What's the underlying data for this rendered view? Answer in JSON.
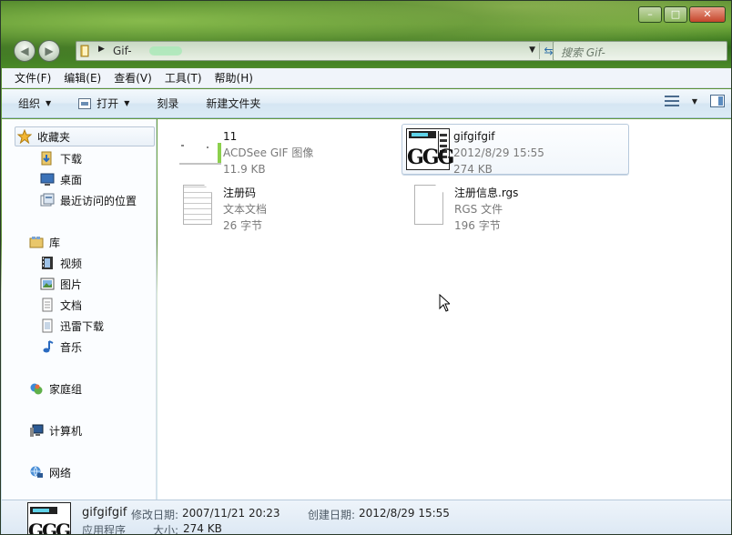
{
  "address": {
    "path": "Gif-"
  },
  "search": {
    "placeholder": "搜索 Gif-"
  },
  "menu": [
    "文件(F)",
    "编辑(E)",
    "查看(V)",
    "工具(T)",
    "帮助(H)"
  ],
  "commands": {
    "organize": "组织",
    "open": "打开",
    "burn": "刻录",
    "new_folder": "新建文件夹"
  },
  "nav": {
    "favorites": "收藏夹",
    "downloads": "下载",
    "desktop": "桌面",
    "recent": "最近访问的位置",
    "libraries": "库",
    "videos": "视频",
    "pictures": "图片",
    "documents": "文档",
    "thunder": "迅雷下载",
    "music": "音乐",
    "homegroup": "家庭组",
    "computer": "计算机",
    "network": "网络"
  },
  "files": [
    {
      "name": "11",
      "type": "ACDSee GIF 图像",
      "size": "11.9 KB"
    },
    {
      "name": "gifgifgif",
      "date": "2012/8/29 15:55",
      "size": "274 KB"
    },
    {
      "name": "注册码",
      "type": "文本文档",
      "size": "26 字节"
    },
    {
      "name": "注册信息.rgs",
      "type": "RGS 文件",
      "size": "196 字节"
    }
  ],
  "details": {
    "name": "gifgifgif",
    "kind": "应用程序",
    "modified_label": "修改日期:",
    "modified": "2007/11/21 20:23",
    "created_label": "创建日期:",
    "created": "2012/8/29 15:55",
    "size_label": "大小:",
    "size": "274 KB"
  }
}
